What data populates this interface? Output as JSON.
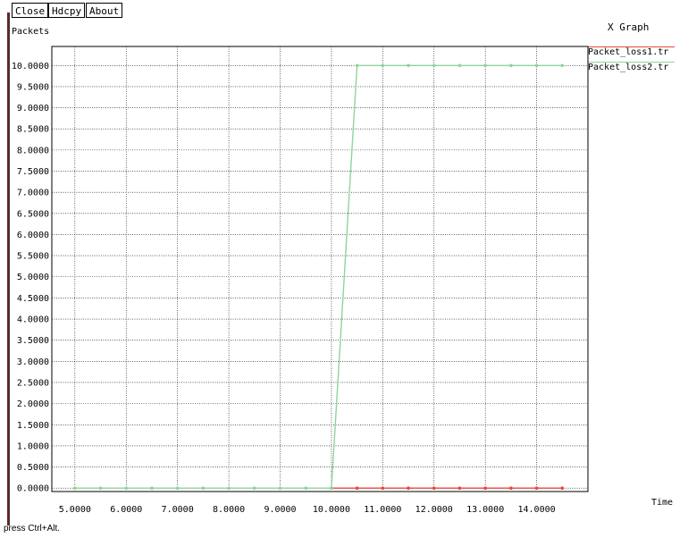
{
  "toolbar": {
    "close_label": "Close",
    "hdcpy_label": "Hdcpy",
    "about_label": "About"
  },
  "window": {
    "title": "X Graph"
  },
  "footer": {
    "hint": "press Ctrl+Alt."
  },
  "colors": {
    "series1": "#e04a3a",
    "series2": "#8fd49a",
    "grid": "#000000"
  },
  "chart_data": {
    "type": "line",
    "title": "",
    "xlabel": "Time",
    "ylabel": "Packets",
    "xlim": [
      4.55,
      15.0
    ],
    "ylim": [
      -0.08,
      10.45
    ],
    "xticks": [
      5.0,
      6.0,
      7.0,
      8.0,
      9.0,
      10.0,
      11.0,
      12.0,
      13.0,
      14.0
    ],
    "yticks": [
      0.0,
      0.5,
      1.0,
      1.5,
      2.0,
      2.5,
      3.0,
      3.5,
      4.0,
      4.5,
      5.0,
      5.5,
      6.0,
      6.5,
      7.0,
      7.5,
      8.0,
      8.5,
      9.0,
      9.5,
      10.0
    ],
    "xtick_labels": [
      "5.0000",
      "6.0000",
      "7.0000",
      "8.0000",
      "9.0000",
      "10.0000",
      "11.0000",
      "12.0000",
      "13.0000",
      "14.0000"
    ],
    "ytick_labels": [
      "0.0000",
      "0.5000",
      "1.0000",
      "1.5000",
      "2.0000",
      "2.5000",
      "3.0000",
      "3.5000",
      "4.0000",
      "4.5000",
      "5.0000",
      "5.5000",
      "6.0000",
      "6.5000",
      "7.0000",
      "7.5000",
      "8.0000",
      "8.5000",
      "9.0000",
      "9.5000",
      "10.0000"
    ],
    "grid": true,
    "legend_position": "top-right-outside",
    "series": [
      {
        "name": "Packet_loss1.tr",
        "x": [
          10.0,
          10.5,
          11.0,
          11.5,
          12.0,
          12.5,
          13.0,
          13.5,
          14.0,
          14.5
        ],
        "y": [
          0,
          0,
          0,
          0,
          0,
          0,
          0,
          0,
          0,
          0
        ]
      },
      {
        "name": "Packet_loss2.tr",
        "x": [
          5.0,
          5.5,
          6.0,
          6.5,
          7.0,
          7.5,
          8.0,
          8.5,
          9.0,
          9.5,
          10.0,
          10.5,
          11.0,
          11.5,
          12.0,
          12.5,
          13.0,
          13.5,
          14.0,
          14.5
        ],
        "y": [
          0,
          0,
          0,
          0,
          0,
          0,
          0,
          0,
          0,
          0,
          0,
          10,
          10,
          10,
          10,
          10,
          10,
          10,
          10,
          10
        ]
      }
    ]
  }
}
